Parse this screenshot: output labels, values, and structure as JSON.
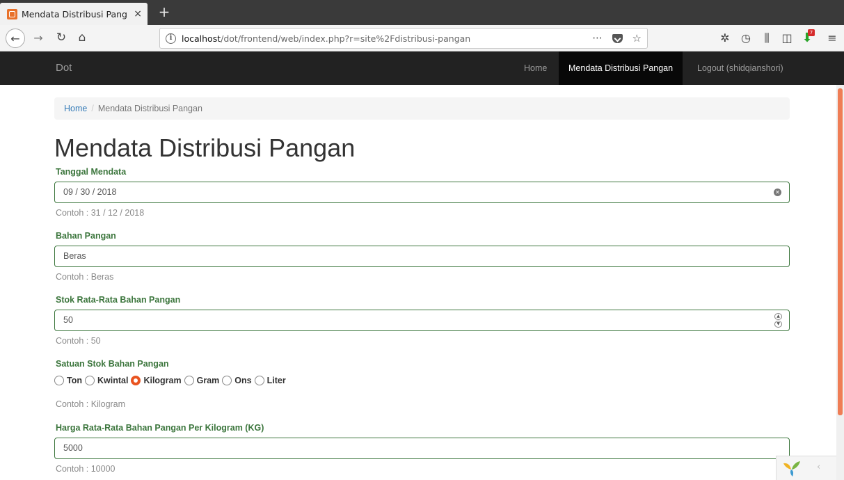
{
  "browser": {
    "tab_title": "Mendata Distribusi Pang",
    "tab_close": "×",
    "new_tab": "+",
    "url_host": "localhost",
    "url_path": "/dot/frontend/web/index.php?r=site%2Fdistribusi-pangan",
    "page_actions": "···",
    "bookmark_star": "☆",
    "download_badge": "7"
  },
  "navbar": {
    "brand": "Dot",
    "items": [
      {
        "label": "Home",
        "active": false
      },
      {
        "label": "Mendata Distribusi Pangan",
        "active": true
      },
      {
        "label": "Logout (shidqianshori)",
        "active": false
      }
    ]
  },
  "breadcrumb": {
    "home": "Home",
    "separator": "/",
    "current": "Mendata Distribusi Pangan"
  },
  "page_title": "Mendata Distribusi Pangan",
  "form": {
    "tanggal": {
      "label": "Tanggal Mendata",
      "value": "09 / 30 / 2018",
      "hint": "Contoh : 31 / 12 / 2018"
    },
    "bahan": {
      "label": "Bahan Pangan",
      "value": "Beras",
      "hint": "Contoh : Beras"
    },
    "stok": {
      "label": "Stok Rata-Rata Bahan Pangan",
      "value": "50",
      "hint": "Contoh : 50"
    },
    "satuan": {
      "label": "Satuan Stok Bahan Pangan",
      "options": [
        "Ton",
        "Kwintal",
        "Kilogram",
        "Gram",
        "Ons",
        "Liter"
      ],
      "selected": "Kilogram",
      "hint": "Contoh : Kilogram"
    },
    "harga": {
      "label": "Harga Rata-Rata Bahan Pangan Per Kilogram (KG)",
      "value": "5000",
      "hint": "Contoh : 10000"
    }
  },
  "colors": {
    "success_green": "#3c763d",
    "accent_orange": "#e95420",
    "navbar_bg": "#222222",
    "link_blue": "#337ab7"
  }
}
